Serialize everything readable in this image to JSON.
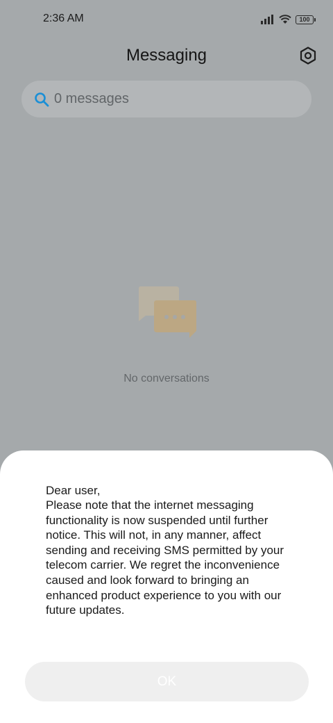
{
  "status_bar": {
    "time": "2:36 AM",
    "battery": "100",
    "signal_icon": "signal-icon",
    "wifi_icon": "wifi-icon",
    "battery_icon": "battery-icon"
  },
  "header": {
    "title": "Messaging",
    "settings_icon": "settings-icon"
  },
  "search": {
    "icon": "search-icon",
    "placeholder": "0 messages"
  },
  "empty_state": {
    "icon": "chat-bubbles-icon",
    "text": "No conversations"
  },
  "dialog": {
    "greeting": "Dear user,",
    "body": "Please note that the internet messaging functionality is now suspended until further notice. This will not, in any manner, affect sending and receiving SMS permitted by your telecom carrier. We regret the inconvenience caused and look forward to bringing an enhanced product experience to you with our future updates.",
    "ok_label": "OK"
  },
  "colors": {
    "overlay_background": "#a5a9ab",
    "search_accent": "#1a8fd6",
    "sheet_background": "#ffffff",
    "button_background": "#efefef"
  }
}
